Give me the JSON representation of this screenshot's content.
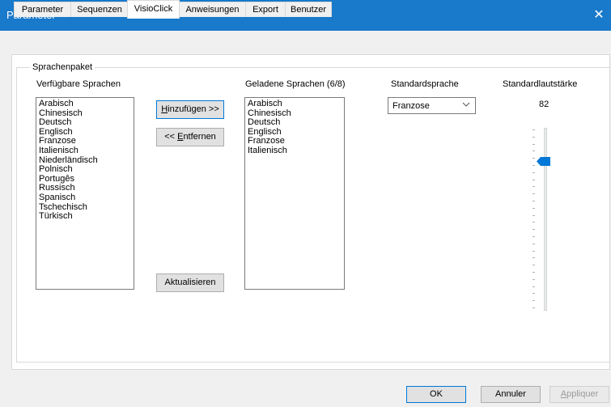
{
  "window": {
    "title": "Parameter",
    "close_glyph": "✕"
  },
  "tabs": [
    "Parameter",
    "Sequenzen",
    "VisioClick",
    "Anweisungen",
    "Export",
    "Benutzer"
  ],
  "active_tab": "VisioClick",
  "group": {
    "title": "Sprachenpaket"
  },
  "available": {
    "label": "Verfügbare Sprachen",
    "items": [
      "Arabisch",
      "Chinesisch",
      "Deutsch",
      "Englisch",
      "Franzose",
      "Italienisch",
      "Niederländisch",
      "Polnisch",
      "Portugês",
      "Russisch",
      "Spanisch",
      "Tschechisch",
      "Türkisch"
    ]
  },
  "buttons": {
    "add": {
      "mnemonic": "H",
      "rest": "inzufügen >>"
    },
    "remove": {
      "prefix": "<< ",
      "mnemonic": "E",
      "rest": "ntfernen"
    },
    "refresh": "Aktualisieren",
    "ok": "OK",
    "cancel": "Annuler",
    "apply": {
      "mnemonic": "A",
      "rest": "ppliquer"
    }
  },
  "loaded": {
    "label": "Geladene Sprachen (6/8)",
    "items": [
      "Arabisch",
      "Chinesisch",
      "Deutsch",
      "Englisch",
      "Franzose",
      "Italienisch"
    ]
  },
  "default_language": {
    "label": "Standardsprache",
    "value": "Franzose"
  },
  "default_volume": {
    "label": "Standardlautstärke",
    "value": "82",
    "level": 82,
    "max": 100
  },
  "colors": {
    "titlebar": "#1979ca",
    "thumb": "#0078d7",
    "focus_border": "#0078d7"
  },
  "icons": {
    "close": "close-icon",
    "dropdown": "chevron-down-icon"
  }
}
